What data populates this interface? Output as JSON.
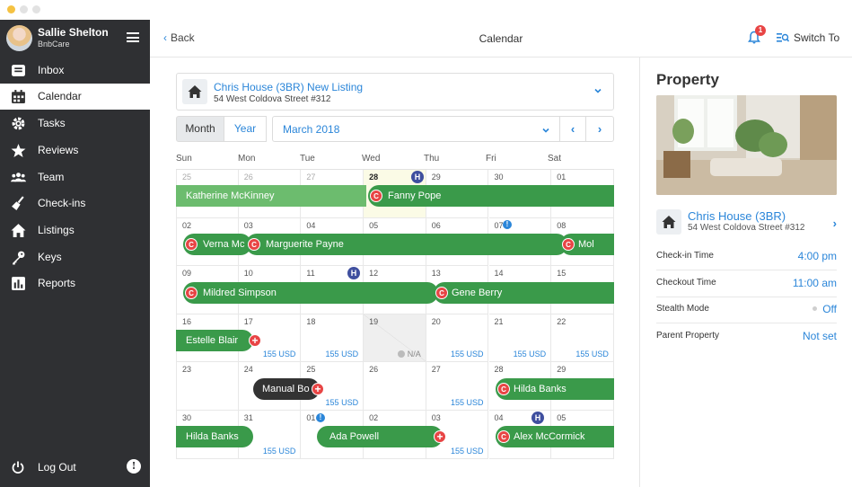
{
  "user": {
    "name": "Sallie Shelton",
    "org": "BnbCare"
  },
  "nav": {
    "items": [
      {
        "label": "Inbox",
        "icon": "inbox-icon"
      },
      {
        "label": "Calendar",
        "icon": "calendar-icon"
      },
      {
        "label": "Tasks",
        "icon": "gear-icon"
      },
      {
        "label": "Reviews",
        "icon": "star-icon"
      },
      {
        "label": "Team",
        "icon": "team-icon"
      },
      {
        "label": "Check-ins",
        "icon": "broom-icon"
      },
      {
        "label": "Listings",
        "icon": "home-icon"
      },
      {
        "label": "Keys",
        "icon": "key-icon"
      },
      {
        "label": "Reports",
        "icon": "chart-icon"
      }
    ],
    "active": "Calendar",
    "logout": "Log Out"
  },
  "header": {
    "back": "Back",
    "title": "Calendar",
    "notification_count": "1",
    "switch": "Switch To"
  },
  "property_select": {
    "name": "Chris House (3BR) New Listing",
    "address": "54 West Coldova Street #312"
  },
  "toolbar": {
    "month": "Month",
    "year": "Year",
    "date": "March 2018",
    "prev": "‹",
    "next": "›"
  },
  "calendar": {
    "weekdays": [
      "Sun",
      "Mon",
      "Tue",
      "Wed",
      "Thu",
      "Fri",
      "Sat"
    ],
    "weeks": [
      [
        "25",
        "26",
        "27",
        "28",
        "29",
        "30",
        "01"
      ],
      [
        "02",
        "03",
        "04",
        "05",
        "06",
        "07",
        "08"
      ],
      [
        "09",
        "10",
        "11",
        "12",
        "13",
        "14",
        "15"
      ],
      [
        "16",
        "17",
        "18",
        "19",
        "20",
        "21",
        "22"
      ],
      [
        "23",
        "24",
        "25",
        "26",
        "27",
        "28",
        "29"
      ],
      [
        "30",
        "31",
        "01",
        "02",
        "03",
        "04",
        "05"
      ]
    ],
    "price": "155 USD",
    "na": "N/A",
    "bookings": {
      "katherine": "Katherine McKinney",
      "fanny": "Fanny Pope",
      "verna": "Verna Mc",
      "marguerite": "Marguerite Payne",
      "mol": "Mol",
      "mildred": "Mildred Simpson",
      "gene": "Gene Berry",
      "estelle": "Estelle Blair",
      "manual": "Manual Bo",
      "hilda1": "Hilda Banks",
      "hilda2": "Hilda Banks",
      "ada": "Ada Powell",
      "alex": "Alex McCormick"
    },
    "badge_c": "C",
    "badge_h": "H",
    "badge_plus": "+",
    "badge_info": "!"
  },
  "panel": {
    "title": "Property",
    "property_name": "Chris House (3BR)",
    "property_address": "54 West Coldova Street #312",
    "rows": [
      {
        "key": "Check-in Time",
        "value": "4:00 pm"
      },
      {
        "key": "Checkout Time",
        "value": "11:00 am"
      },
      {
        "key": "Stealth Mode",
        "value": "Off"
      },
      {
        "key": "Parent Property",
        "value": "Not set"
      }
    ]
  },
  "colors": {
    "accent": "#2b86d9",
    "booking": "#3a9a4a",
    "badge": "#e84545",
    "sidebar": "#2f3033"
  }
}
